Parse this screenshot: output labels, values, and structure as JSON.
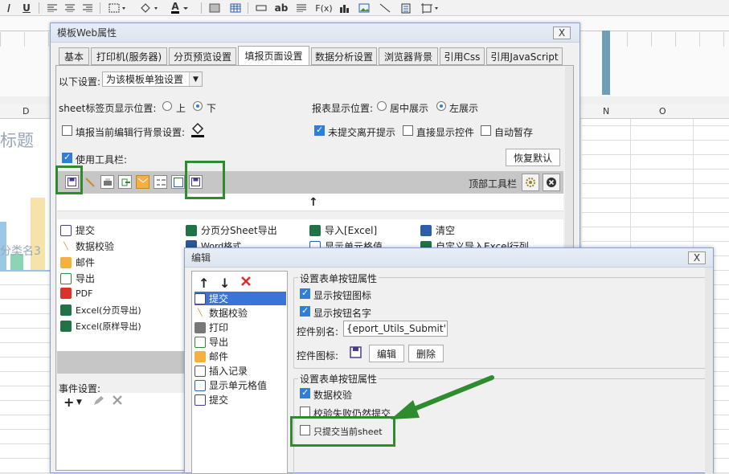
{
  "top_toolbar": {
    "underline_label": "U",
    "text_icon_label": "ab",
    "fx_label": "F(x)",
    "font_color_label": "A"
  },
  "sheet": {
    "col_d": "D",
    "col_n": "N",
    "col_o": "O",
    "chart_title_partial": "标题",
    "category_partial": "分类名3",
    "bar_colors": [
      "#9cc8e8",
      "#8cd4b4",
      "#f6e3a9"
    ]
  },
  "main_dialog": {
    "title": "模板Web属性",
    "close": "X",
    "tabs": [
      "基本",
      "打印机(服务器)",
      "分页预览设置",
      "填报页面设置",
      "数据分析设置",
      "浏览器背景",
      "引用Css",
      "引用JavaScript"
    ],
    "active_tab": "填报页面设置",
    "settings_label": "以下设置:",
    "settings_value": "为该模板单独设置",
    "sheet_tab_pos_label": "sheet标签页显示位置:",
    "sheet_tab_top": "上",
    "sheet_tab_bottom": "下",
    "report_pos_label": "报表显示位置:",
    "report_pos_center": "居中展示",
    "report_pos_left": "左展示",
    "fill_bg_label": "填报当前编辑行背景设置:",
    "unsubmitted_label": "未提交离开提示",
    "show_ctrl_label": "直接显示控件",
    "autosave_label": "自动暂存",
    "use_toolbar_label": "使用工具栏:",
    "restore_default": "恢复默认",
    "top_toolbar_label": "顶部工具栏",
    "arrow_up": "↑",
    "buttons_col1": [
      "提交",
      "数据校验",
      "邮件",
      "导出",
      "PDF",
      "Excel(分页导出)",
      "Excel(原样导出)"
    ],
    "buttons_col2": [
      "分页分Sheet导出",
      "Word格式"
    ],
    "buttons_col3": [
      "导入[Excel]",
      "显示单元格值"
    ],
    "buttons_col4": [
      "清空",
      "自定义导入Excel行列"
    ],
    "event_settings_label": "事件设置:"
  },
  "edit_dialog": {
    "title": "编辑",
    "close": "X",
    "list_items": [
      "提交",
      "数据校验",
      "打印",
      "导出",
      "邮件",
      "插入记录",
      "显示单元格值",
      "提交"
    ],
    "selected_item": "提交",
    "group1_title": "设置表单按钮属性",
    "show_icon": "显示按钮图标",
    "show_name": "显示按钮名字",
    "alias_label": "控件别名:",
    "alias_value": "{eport_Utils_Submit')}",
    "icon_label": "控件图标:",
    "edit_btn": "编辑",
    "delete_btn": "删除",
    "group2_title": "设置表单按钮属性",
    "data_validate": "数据校验",
    "fail_submit": "校验失败仍然提交",
    "submit_current_sheet": "只提交当前sheet"
  },
  "colors": {
    "highlight_green": "#2e8b2e",
    "selection_blue": "#3875d7",
    "checkbox_blue": "#2f7ed8"
  }
}
